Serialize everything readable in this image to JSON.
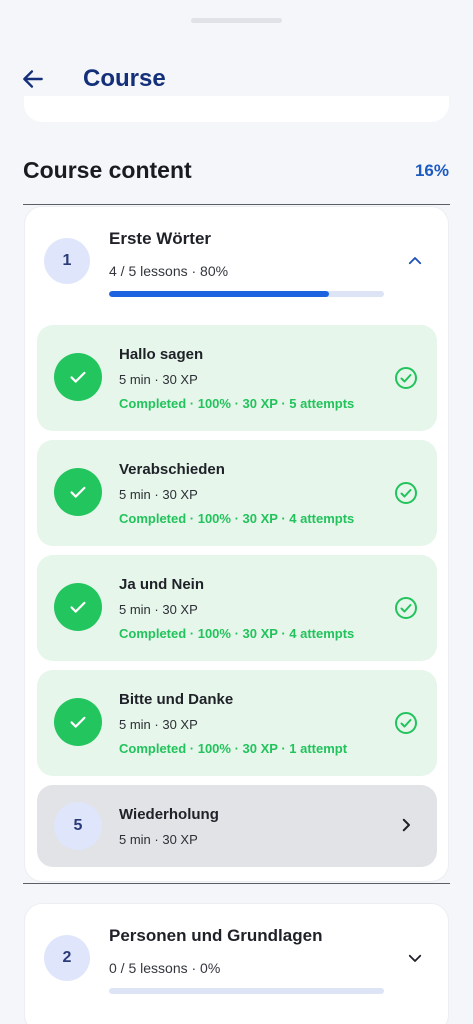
{
  "header": {
    "title": "Course"
  },
  "section": {
    "title": "Course content",
    "progress_label": "16%"
  },
  "modules": [
    {
      "number": "1",
      "title": "Erste Wörter",
      "summary": "4 / 5 lessons · 80%",
      "progress": 0.8,
      "expanded": true,
      "lessons": [
        {
          "title": "Hallo sagen",
          "meta": "5 min · 30 XP",
          "status": "Completed · 100% · 30 XP · 5 attempts"
        },
        {
          "title": "Verabschieden",
          "meta": "5 min · 30 XP",
          "status": "Completed · 100% · 30 XP · 4 attempts"
        },
        {
          "title": "Ja und Nein",
          "meta": "5 min · 30 XP",
          "status": "Completed · 100% · 30 XP · 4 attempts"
        },
        {
          "title": "Bitte und Danke",
          "meta": "5 min · 30 XP",
          "status": "Completed · 100% · 30 XP · 1 attempt"
        }
      ],
      "next_lesson": {
        "number": "5",
        "title": "Wiederholung",
        "meta": "5 min · 30 XP"
      }
    },
    {
      "number": "2",
      "title": "Personen und Grundlagen",
      "summary": "0 / 5 lessons · 0%",
      "progress": 0,
      "expanded": false
    }
  ],
  "colors": {
    "accent": "#1d63e0",
    "title_blue": "#14307a",
    "success": "#22c35c"
  },
  "icons": [
    "back-arrow-icon",
    "chevron-up-icon",
    "chevron-down-icon",
    "check-icon",
    "check-circle-icon",
    "chevron-right-icon"
  ]
}
